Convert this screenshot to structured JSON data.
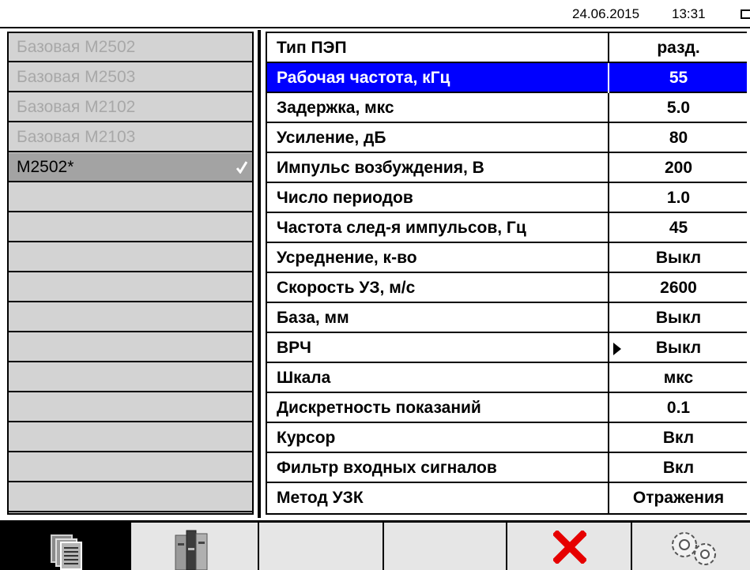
{
  "status": {
    "date": "24.06.2015",
    "time": "13:31",
    "battery_icon": "battery-icon"
  },
  "profiles": {
    "items": [
      {
        "label": "Базовая М2502",
        "state": "disabled"
      },
      {
        "label": "Базовая М2503",
        "state": "disabled"
      },
      {
        "label": "Базовая М2102",
        "state": "disabled"
      },
      {
        "label": "Базовая М2103",
        "state": "disabled"
      },
      {
        "label": "М2502*",
        "state": "selected",
        "icon": "checkmark-icon"
      },
      {
        "label": ""
      },
      {
        "label": ""
      },
      {
        "label": ""
      },
      {
        "label": ""
      },
      {
        "label": ""
      },
      {
        "label": ""
      },
      {
        "label": ""
      },
      {
        "label": ""
      },
      {
        "label": ""
      },
      {
        "label": ""
      },
      {
        "label": ""
      }
    ]
  },
  "params": {
    "rows": [
      {
        "name": "Тип ПЭП",
        "value": "разд."
      },
      {
        "name": "Рабочая частота, кГц",
        "value": "55"
      },
      {
        "name": "Задержка, мкс",
        "value": "5.0"
      },
      {
        "name": "Усиление, дБ",
        "value": "80"
      },
      {
        "name": "Импульс возбуждения, В",
        "value": "200"
      },
      {
        "name": "Число периодов",
        "value": "1.0"
      },
      {
        "name": "Частота след-я импульсов, Гц",
        "value": "45"
      },
      {
        "name": "Усреднение, к-во",
        "value": "Выкл"
      },
      {
        "name": "Скорость УЗ, м/с",
        "value": "2600"
      },
      {
        "name": "База, мм",
        "value": "Выкл"
      },
      {
        "name": "ВРЧ",
        "value": "Выкл"
      },
      {
        "name": "Шкала",
        "value": "мкс"
      },
      {
        "name": "Дискретность показаний",
        "value": "0.1"
      },
      {
        "name": "Курсор",
        "value": "Вкл"
      },
      {
        "name": "Фильтр входных сигналов",
        "value": "Вкл"
      },
      {
        "name": "Метод УЗК",
        "value": "Отражения"
      }
    ],
    "highlighted_row": "Рабочая частота, кГц",
    "submenu_row": "ВРЧ",
    "highlight_color": "#0000ff"
  },
  "toolbar": {
    "buttons": [
      {
        "icon": "documents-icon",
        "active": true
      },
      {
        "icon": "archive-icon"
      },
      {
        "icon": ""
      },
      {
        "icon": ""
      },
      {
        "icon": "close-icon",
        "color": "#e60000"
      },
      {
        "icon": "settings-gears-icon"
      }
    ]
  }
}
